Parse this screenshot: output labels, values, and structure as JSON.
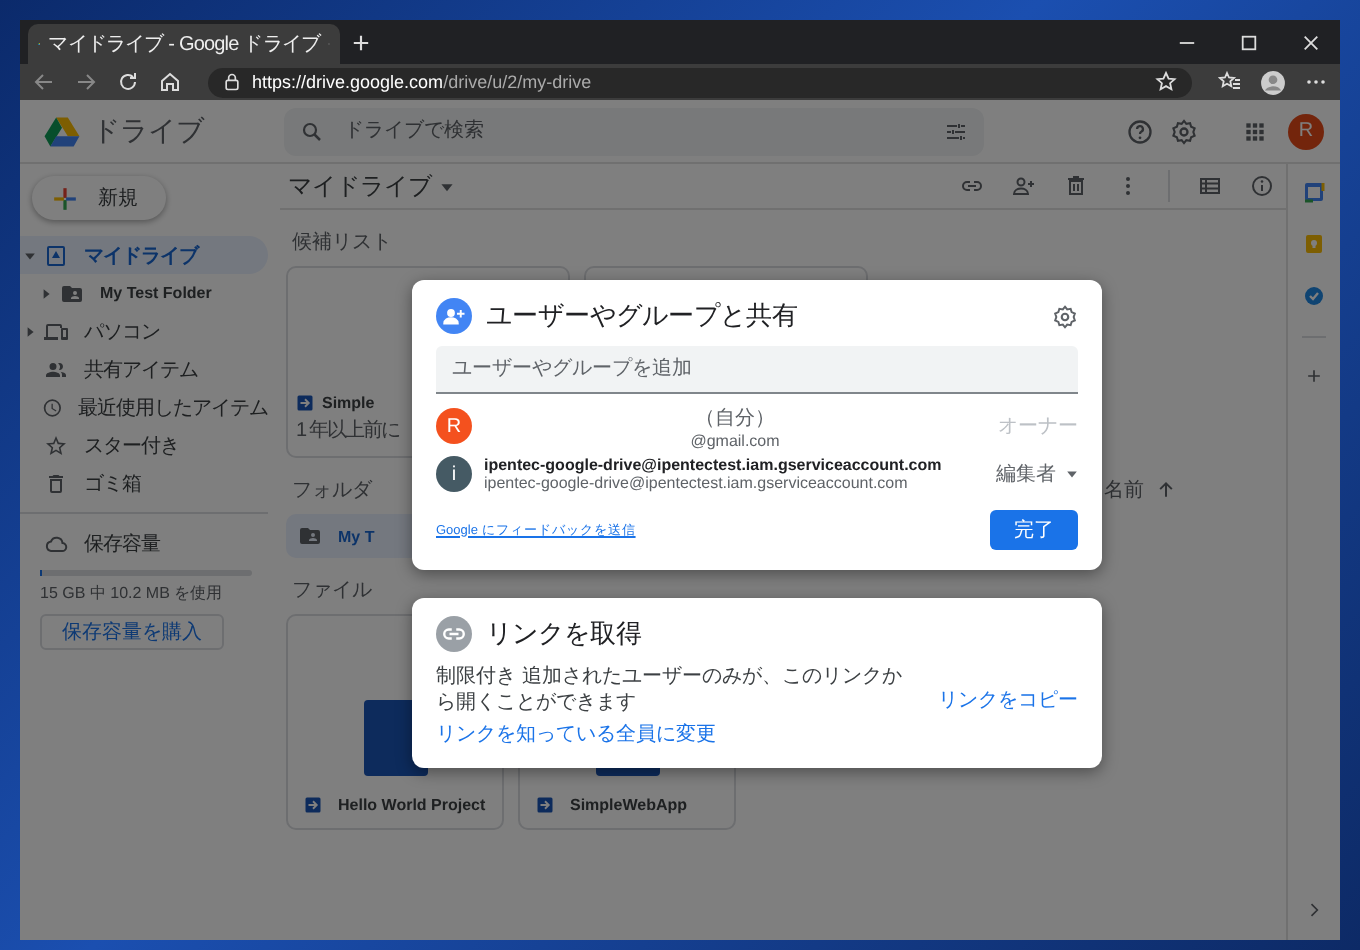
{
  "browser": {
    "tab_title": "マイドライブ - Google ドライブ",
    "url": {
      "origin": "https://drive.google.com",
      "path": "/drive/u/2/my-drive"
    }
  },
  "app": {
    "name": "ドライブ",
    "search": {
      "placeholder": "ドライブで検索"
    },
    "avatar": "R"
  },
  "sidebar": {
    "new_button": "新規",
    "items": [
      {
        "label": "マイドライブ",
        "selected": true,
        "expanded": true,
        "children": [
          {
            "label": "My Test Folder",
            "selected": false,
            "expanded": false
          }
        ]
      },
      {
        "label": "パソコン",
        "selected": false,
        "expanded": false
      },
      {
        "label": "共有アイテム",
        "selected": false
      },
      {
        "label": "最近使用したアイテム",
        "selected": false
      },
      {
        "label": "スター付き",
        "selected": false
      },
      {
        "label": "ゴミ箱",
        "selected": false
      }
    ],
    "storage": {
      "label": "保存容量",
      "level": 0.001,
      "usage": "15 GB 中 10.2 MB を使用",
      "buy_button": "保存容量を購入"
    }
  },
  "main": {
    "title": "マイドライブ",
    "suggested": {
      "label": "候補リスト",
      "cards": [
        {
          "name": "Simple",
          "meta": "1 年以上前に"
        }
      ]
    },
    "folders": {
      "label": "フォルダ",
      "sort": "名前",
      "items": [
        {
          "name": "My T"
        }
      ]
    },
    "files": {
      "label": "ファイル",
      "items": [
        {
          "name": "Hello World Project"
        },
        {
          "name": "SimpleWebApp"
        }
      ]
    }
  },
  "share_dialog": {
    "title": "ユーザーやグループと共有",
    "input": {
      "placeholder": "ユーザーやグループを追加"
    },
    "people": [
      {
        "kind": "self",
        "avatar": "R",
        "color": "#f4511e",
        "name": "（自分）",
        "email": "@gmail.com",
        "role": "オーナー"
      },
      {
        "kind": "member",
        "avatar": "i",
        "color": "#455a64",
        "name": "ipentec-google-drive@ipentectest.iam.gserviceaccount.com",
        "email": "ipentec-google-drive@ipentectest.iam.gserviceaccount.com",
        "role": "編集者"
      }
    ],
    "feedback_link": "Google にフィードバックを送信",
    "done_button": "完了"
  },
  "link_dialog": {
    "title": "リンクを取得",
    "description": "制限付き 追加されたユーザーのみが、このリンクから開くことができます",
    "change_link": "リンクを知っている全員に変更",
    "copy_link": "リンクをコピー"
  }
}
